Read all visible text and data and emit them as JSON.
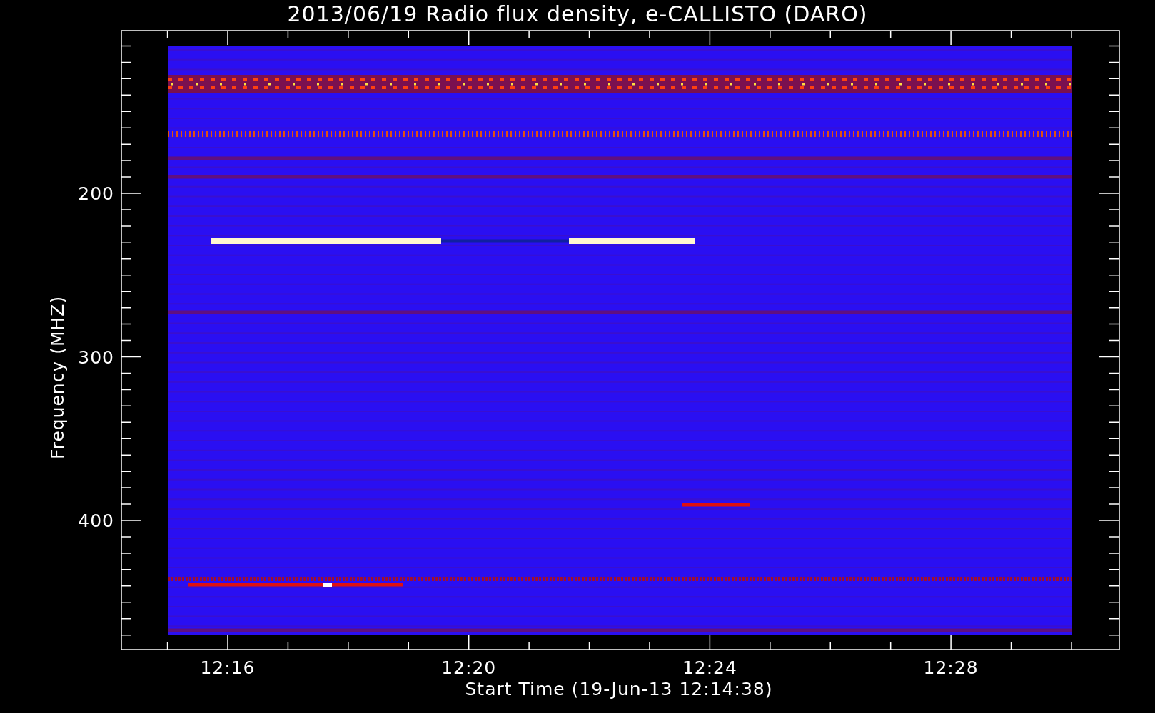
{
  "title": "2013/06/19  Radio flux density, e-CALLISTO (DARO)",
  "xlabel": "Start Time (19-Jun-13 12:14:38)",
  "ylabel": "Frequency (MHZ)",
  "xticks": [
    {
      "label": "12:16"
    },
    {
      "label": "12:20"
    },
    {
      "label": "12:24"
    },
    {
      "label": "12:28"
    }
  ],
  "yticks": [
    {
      "label": "200"
    },
    {
      "label": "300"
    },
    {
      "label": "400"
    }
  ]
}
